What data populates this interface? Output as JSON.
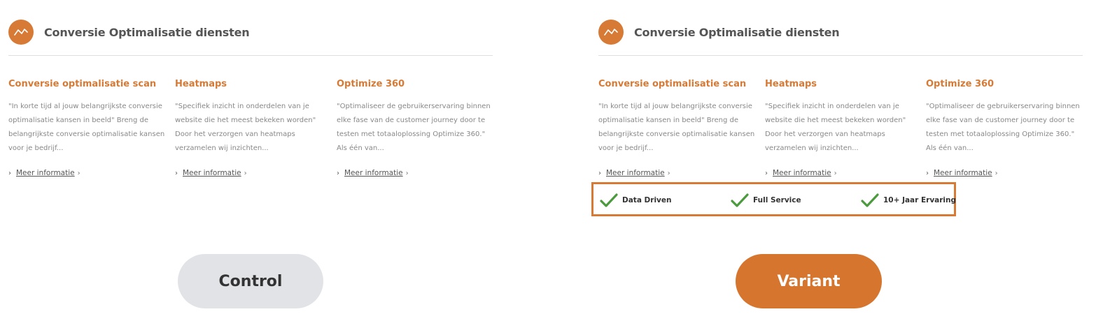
{
  "colors": {
    "accent": "#d67a35",
    "check": "#4c9a3e",
    "control_pill": "#e1e3e6",
    "variant_pill": "#d5752e"
  },
  "section": {
    "icon": "line-chart-icon",
    "title": "Conversie Optimalisatie diensten"
  },
  "services": [
    {
      "title": "Conversie optimalisatie scan",
      "description": "\"In korte tijd al jouw belangrijkste conversie optimalisatie kansen in beeld\" Breng de belangrijkste conversie optimalisatie kansen voor je bedrijf...",
      "link": "Meer informatie",
      "link_suffix": "›"
    },
    {
      "title": "Heatmaps",
      "description": "\"Specifiek inzicht in onderdelen van je website die het meest bekeken worden\" Door het verzorgen van heatmaps verzamelen wij inzichten...",
      "link": "Meer informatie",
      "link_suffix": "›"
    },
    {
      "title": "Optimize 360",
      "description": "\"Optimaliseer de gebruikerservaring binnen elke fase van de customer journey door te testen met totaaloplossing Optimize 360.\" Als één van...",
      "link": "Meer informatie",
      "link_suffix": "›"
    }
  ],
  "link_chevron": "›",
  "usps": [
    {
      "icon": "checkmark-icon",
      "label": "Data Driven"
    },
    {
      "icon": "checkmark-icon",
      "label": "Full Service"
    },
    {
      "icon": "checkmark-icon",
      "label": "10+ Jaar Ervaring"
    }
  ],
  "labels": {
    "control": "Control",
    "variant": "Variant"
  }
}
